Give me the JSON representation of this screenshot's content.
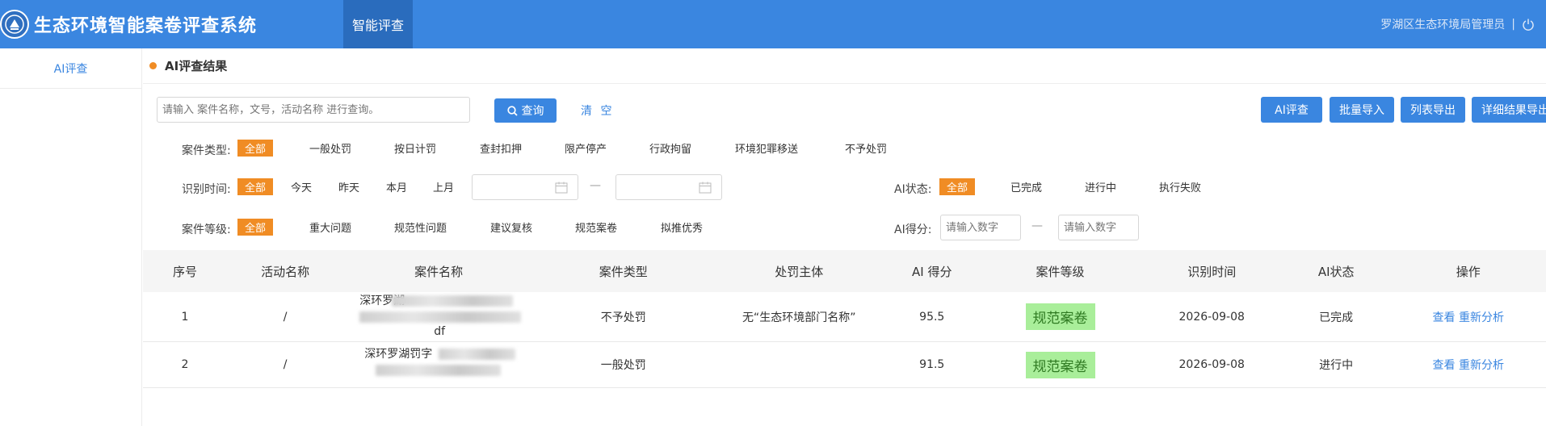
{
  "header": {
    "app_title": "生态环境智能案卷评查系统",
    "nav_tab": "智能评查",
    "user_label": "罗湖区生态环境局管理员",
    "separator": "|"
  },
  "sidebar": {
    "items": [
      {
        "label": "AI评查"
      }
    ]
  },
  "section": {
    "title": "AI评查结果"
  },
  "search": {
    "placeholder": "请输入 案件名称，文号，活动名称 进行查询。",
    "search_label": "查询",
    "clear_label": "清 空",
    "actions": [
      "AI评查",
      "批量导入",
      "列表导出",
      "详细结果导出"
    ]
  },
  "filters": {
    "case_type": {
      "label": "案件类型:",
      "options": [
        "全部",
        "一般处罚",
        "按日计罚",
        "查封扣押",
        "限产停产",
        "行政拘留",
        "环境犯罪移送",
        "不予处罚"
      ],
      "selected": "全部"
    },
    "time": {
      "label": "识别时间:",
      "options": [
        "全部",
        "今天",
        "昨天",
        "本月",
        "上月"
      ],
      "selected": "全部",
      "range_sep": "—"
    },
    "ai_status": {
      "label": "AI状态:",
      "options": [
        "全部",
        "已完成",
        "进行中",
        "执行失败"
      ],
      "selected": "全部"
    },
    "case_level": {
      "label": "案件等级:",
      "options": [
        "全部",
        "重大问题",
        "规范性问题",
        "建议复核",
        "规范案卷",
        "拟推优秀"
      ],
      "selected": "全部"
    },
    "ai_score": {
      "label": "AI得分:",
      "placeholder": "请输入数字",
      "range_sep": "—"
    }
  },
  "table": {
    "columns": [
      "序号",
      "活动名称",
      "案件名称",
      "案件类型",
      "处罚主体",
      "AI 得分",
      "案件等级",
      "识别时间",
      "AI状态",
      "操作"
    ],
    "rows": [
      {
        "index": "1",
        "activity": "/",
        "name_line1": "深环罗湖",
        "name_line2": "",
        "name_line3": "df",
        "type": "不予处罚",
        "subject": "无“生态环境部门名称”",
        "score": "95.5",
        "level": "规范案卷",
        "time": "2026-09-08",
        "status": "已完成",
        "view": "查看",
        "reanalyze": "重新分析"
      },
      {
        "index": "2",
        "activity": "/",
        "name_line1": "深环罗湖罚字",
        "name_line2": "",
        "name_line3": "",
        "type": "一般处罚",
        "subject": "",
        "score": "91.5",
        "level": "规范案卷",
        "time": "2026-09-08",
        "status": "进行中",
        "view": "查看",
        "reanalyze": "重新分析"
      }
    ]
  },
  "colors": {
    "primary": "#3a86e0",
    "accent": "#f08c24",
    "badge_bg": "#a9ee9a",
    "badge_text": "#2f7a22"
  },
  "icons": [
    "emblem-icon",
    "power-icon",
    "search-icon",
    "calendar-icon"
  ]
}
